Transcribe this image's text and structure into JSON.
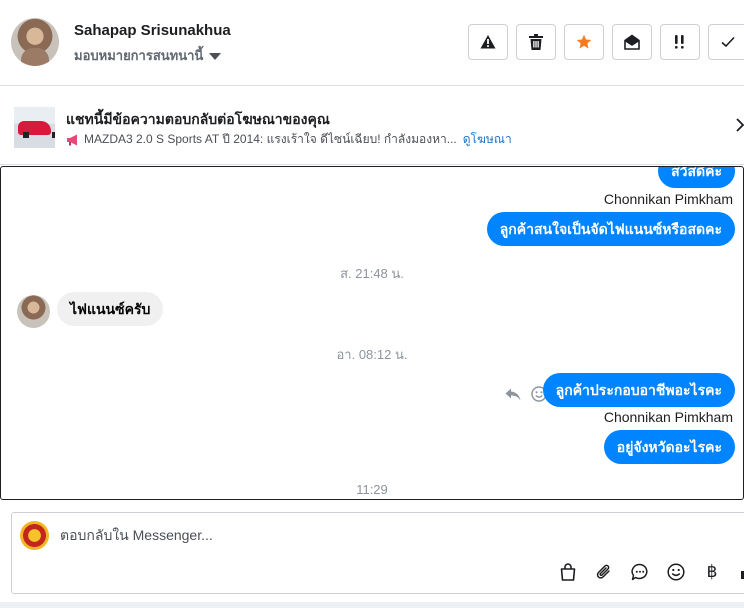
{
  "header": {
    "contact_name": "Sahapap Srisunakhua",
    "assign_label": "มอบหมายการสนทนานี้",
    "tools": [
      {
        "name": "warning-icon",
        "color": "#1c1e21"
      },
      {
        "name": "trash-icon",
        "color": "#1c1e21"
      },
      {
        "name": "star-icon",
        "color": "#f57c20"
      },
      {
        "name": "envelope-open-icon",
        "color": "#1c1e21"
      },
      {
        "name": "follow-up-icon",
        "color": "#1c1e21"
      },
      {
        "name": "check-icon",
        "color": "#1c1e21"
      }
    ]
  },
  "ad": {
    "title": "แชทนี้มีข้อความตอบกลับต่อโฆษณาของคุณ",
    "summary": "MAZDA3 2.0 S Sports AT ปี 2014: แรงเร้าใจ ดีไซน์เฉียบ! กำลังมองหา...",
    "link": "ดูโฆษณา"
  },
  "messages": {
    "out_1": "สวัสดีค่ะ",
    "sender_1": "Chonnikan Pimkham",
    "out_2": "ลูกค้าสนใจเป็นจัดไฟแนนซ์หรือสดคะ",
    "time_1": "ส. 21:48 น.",
    "in_1": "ไฟแนนซ์ครับ",
    "time_2": "อา. 08:12 น.",
    "out_3": "ลูกค้าประกอบอาชีพอะไรคะ",
    "sender_2": "Chonnikan Pimkham",
    "out_4": "อยู่จังหวัดอะไรคะ",
    "time_3": "11:29"
  },
  "composer": {
    "placeholder": "ตอบกลับใน Messenger...",
    "tools": [
      "shopping-bag-icon",
      "paperclip-icon",
      "saved-reply-icon",
      "emoji-icon",
      "baht-payment-icon",
      "like-icon"
    ]
  },
  "colors": {
    "accent": "#0084ff",
    "link": "#2276c9",
    "star": "#f57c20"
  }
}
